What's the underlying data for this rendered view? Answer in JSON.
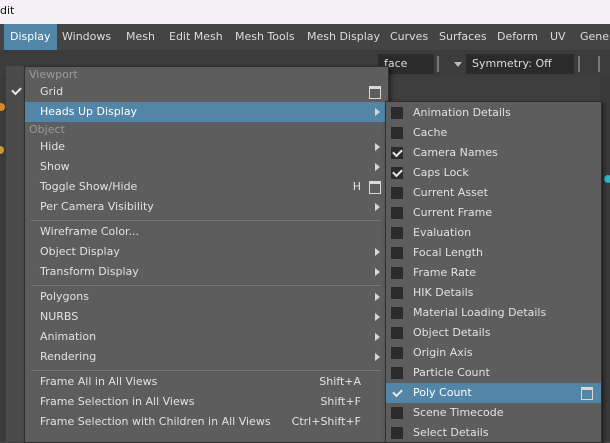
{
  "titlebar": {
    "text": "dit"
  },
  "menubar": {
    "items": [
      "Display",
      "Windows",
      "Mesh",
      "Edit Mesh",
      "Mesh Tools",
      "Mesh Display",
      "Curves",
      "Surfaces",
      "Deform",
      "UV",
      "Gener"
    ]
  },
  "shelf": {
    "face_field": "face",
    "symmetry": "Symmetry: Off"
  },
  "main_menu": {
    "section_viewport": "Viewport",
    "grid": "Grid",
    "hud": "Heads Up Display",
    "section_object": "Object",
    "hide": "Hide",
    "show": "Show",
    "toggle_show_hide": "Toggle Show/Hide",
    "toggle_show_hide_shortcut": "H",
    "per_camera_visibility": "Per Camera Visibility",
    "wireframe_color": "Wireframe Color...",
    "object_display": "Object Display",
    "transform_display": "Transform Display",
    "polygons": "Polygons",
    "nurbs": "NURBS",
    "animation": "Animation",
    "rendering": "Rendering",
    "frame_all": "Frame All in All Views",
    "frame_all_shortcut": "Shift+A",
    "frame_selection": "Frame Selection in All Views",
    "frame_selection_shortcut": "Shift+F",
    "frame_selection_children": "Frame Selection with Children in All Views",
    "frame_selection_children_shortcut": "Ctrl+Shift+F"
  },
  "hud_menu": {
    "items": [
      {
        "label": "Animation Details",
        "checked": false
      },
      {
        "label": "Cache",
        "checked": false
      },
      {
        "label": "Camera Names",
        "checked": true
      },
      {
        "label": "Caps Lock",
        "checked": true
      },
      {
        "label": "Current Asset",
        "checked": false
      },
      {
        "label": "Current Frame",
        "checked": false
      },
      {
        "label": "Evaluation",
        "checked": false
      },
      {
        "label": "Focal Length",
        "checked": false
      },
      {
        "label": "Frame Rate",
        "checked": false
      },
      {
        "label": "HIK Details",
        "checked": false
      },
      {
        "label": "Material Loading Details",
        "checked": false
      },
      {
        "label": "Object Details",
        "checked": false
      },
      {
        "label": "Origin Axis",
        "checked": false
      },
      {
        "label": "Particle Count",
        "checked": false
      },
      {
        "label": "Poly Count",
        "checked": true
      },
      {
        "label": "Scene Timecode",
        "checked": false
      },
      {
        "label": "Select Details",
        "checked": false
      }
    ]
  },
  "colors": {
    "highlight": "#5285a6",
    "menu_bg": "#5d5d5d"
  }
}
